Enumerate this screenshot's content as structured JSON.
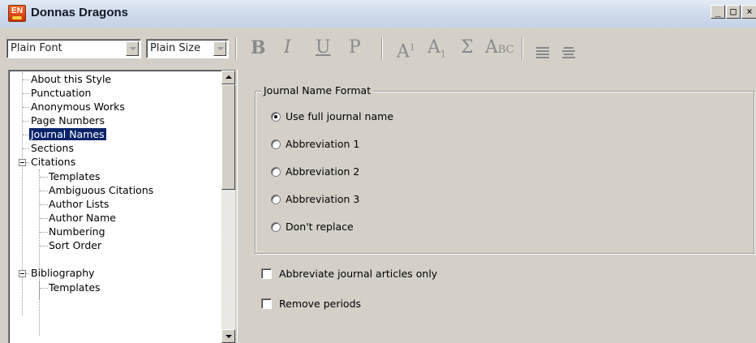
{
  "window": {
    "title": "Donnas Dragons",
    "app_icon_text": "EN",
    "minimize_label": "_",
    "maximize_label": "□",
    "close_label": "×"
  },
  "toolbar": {
    "font_value": "Plain Font",
    "size_value": "Plain Size",
    "bold": "B",
    "italic": "I",
    "underline": "U",
    "plain": "P",
    "superscript_base": "A",
    "superscript_mark": "1",
    "subscript_base": "A",
    "subscript_mark": "1",
    "symbol": "Σ",
    "smallcaps_base": "A",
    "smallcaps_rest": "BC",
    "icons": [
      "align-left-icon",
      "align-center-icon"
    ]
  },
  "tree": {
    "items": [
      {
        "label": "About this Style"
      },
      {
        "label": "Punctuation"
      },
      {
        "label": "Anonymous Works"
      },
      {
        "label": "Page Numbers"
      },
      {
        "label": "Journal Names",
        "selected": true
      },
      {
        "label": "Sections"
      },
      {
        "label": "Citations",
        "expanded": true
      },
      {
        "label": "Templates"
      },
      {
        "label": "Ambiguous Citations"
      },
      {
        "label": "Author Lists"
      },
      {
        "label": "Author Name"
      },
      {
        "label": "Numbering"
      },
      {
        "label": "Sort Order"
      },
      {
        "label": "Bibliography",
        "expanded": true
      },
      {
        "label": "Templates"
      }
    ]
  },
  "journal_format": {
    "group_title": "Journal Name Format",
    "options": [
      {
        "label": "Use full journal name",
        "checked": true
      },
      {
        "label": "Abbreviation 1",
        "checked": false
      },
      {
        "label": "Abbreviation 2",
        "checked": false
      },
      {
        "label": "Abbreviation 3",
        "checked": false
      },
      {
        "label": "Don't replace",
        "checked": false
      }
    ]
  },
  "checkboxes": [
    {
      "label": "Abbreviate journal articles only",
      "checked": false
    },
    {
      "label": "Remove periods",
      "checked": false
    }
  ],
  "colors": {
    "selection": "#0a246a",
    "face": "#d4d0c8"
  }
}
